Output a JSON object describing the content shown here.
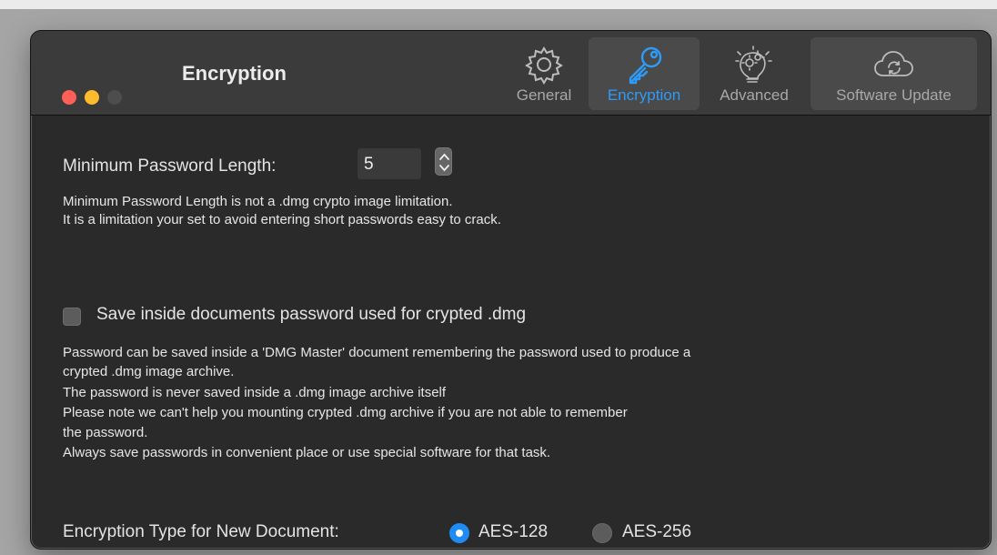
{
  "window": {
    "title": "Encryption"
  },
  "toolbar": {
    "items": [
      {
        "label": "General",
        "icon": "gear-icon"
      },
      {
        "label": "Encryption",
        "icon": "key-icon"
      },
      {
        "label": "Advanced",
        "icon": "lightbulb-gears-icon"
      },
      {
        "label": "Software Update",
        "icon": "cloud-sync-icon"
      }
    ],
    "selected": "Encryption",
    "accent_color": "#2d9cf8"
  },
  "min_password": {
    "label": "Minimum Password Length:",
    "value": "5",
    "help_lines": [
      "Minimum Password Length is not a .dmg crypto image limitation.",
      "It is a limitation your set to avoid entering short passwords easy to crack."
    ]
  },
  "save_password": {
    "label": "Save inside documents password used for crypted .dmg",
    "checked": false,
    "help_lines": [
      "Password can be saved inside a 'DMG Master' document remembering the password used to produce a",
      "crypted .dmg image archive.",
      "The password is never saved inside a .dmg image archive itself",
      "Please note we can't help you mounting crypted .dmg archive if you are not able to remember",
      "the password.",
      "Always save passwords in convenient place or use special software for that task."
    ]
  },
  "encryption_type": {
    "label": "Encryption Type for New Document:",
    "options": [
      "AES-128",
      "AES-256"
    ],
    "selected": "AES-128"
  }
}
